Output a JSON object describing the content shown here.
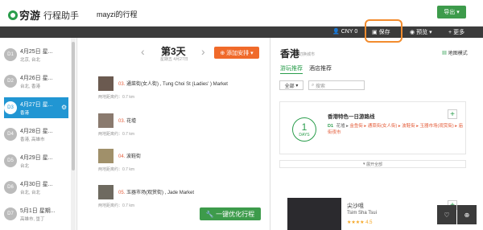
{
  "app": {
    "logo": "穷游",
    "logo_sub": "行程助手",
    "trip_title": "mayzi的行程",
    "export_label": "导出"
  },
  "toolbar": {
    "currency": "CNY 0",
    "save": "保存",
    "preview": "预览",
    "more": "更多"
  },
  "days": [
    {
      "num": "D1",
      "date": "4月25日 星...",
      "places": "北京, 台北"
    },
    {
      "num": "D2",
      "date": "4月26日 星...",
      "places": "台北, 香港"
    },
    {
      "num": "D3",
      "date": "4月27日 星...",
      "places": "香港"
    },
    {
      "num": "D4",
      "date": "4月28日 星...",
      "places": "香港, 高雄市"
    },
    {
      "num": "D5",
      "date": "4月29日 星...",
      "places": "台北"
    },
    {
      "num": "D6",
      "date": "4月30日 星...",
      "places": "台北, 台北"
    },
    {
      "num": "D7",
      "date": "5月1日 星期...",
      "places": "高雄市, 垦丁"
    }
  ],
  "day_detail": {
    "title": "第3天",
    "sub": "星期五 4月27日",
    "add_btn": "添加安排",
    "pois": [
      {
        "num": "03.",
        "name": "通菜街(女人街) , Tung Choi St (Ladies' ) Market",
        "dist": "两地距离约：0.7 km"
      },
      {
        "num": "03.",
        "name": "花墟",
        "dist": "两地距离约：0.7 km"
      },
      {
        "num": "04.",
        "name": "波鞋街",
        "dist": "两地距离约：0.7 km"
      },
      {
        "num": "05.",
        "name": "玉器市场(观赏街) , Jade Market",
        "dist": "两地距离约：0.7 km"
      }
    ],
    "optimize_btn": "一键优化行程"
  },
  "right": {
    "city": "香港",
    "city_sub": "切换城市",
    "map_mode": "地图模式",
    "tabs": [
      "游玩推荐",
      "酒店推荐"
    ],
    "filter": "全部",
    "search_placeholder": "搜索",
    "route": {
      "days_num": "1",
      "days_label": "DAYS",
      "title": "香港特色一日游路线",
      "day_tag": "D1",
      "path_prefix": "花墟 ▸ ",
      "path": "金鱼街 ▸ 通菜街(女人街) ▸ 波鞋街 ▸ 玉器市场(观赏街) ▸ 庙街夜市"
    },
    "expand": "展开全部",
    "poi2": {
      "name": "尖沙咀",
      "sub": "Tsim Sha Tsui",
      "stars": "★★★★ 4.5"
    }
  },
  "colors": {
    "green": "#3d9b4b",
    "blue": "#2196d3",
    "orange": "#f06a2a",
    "dark": "#3b3b3b"
  }
}
